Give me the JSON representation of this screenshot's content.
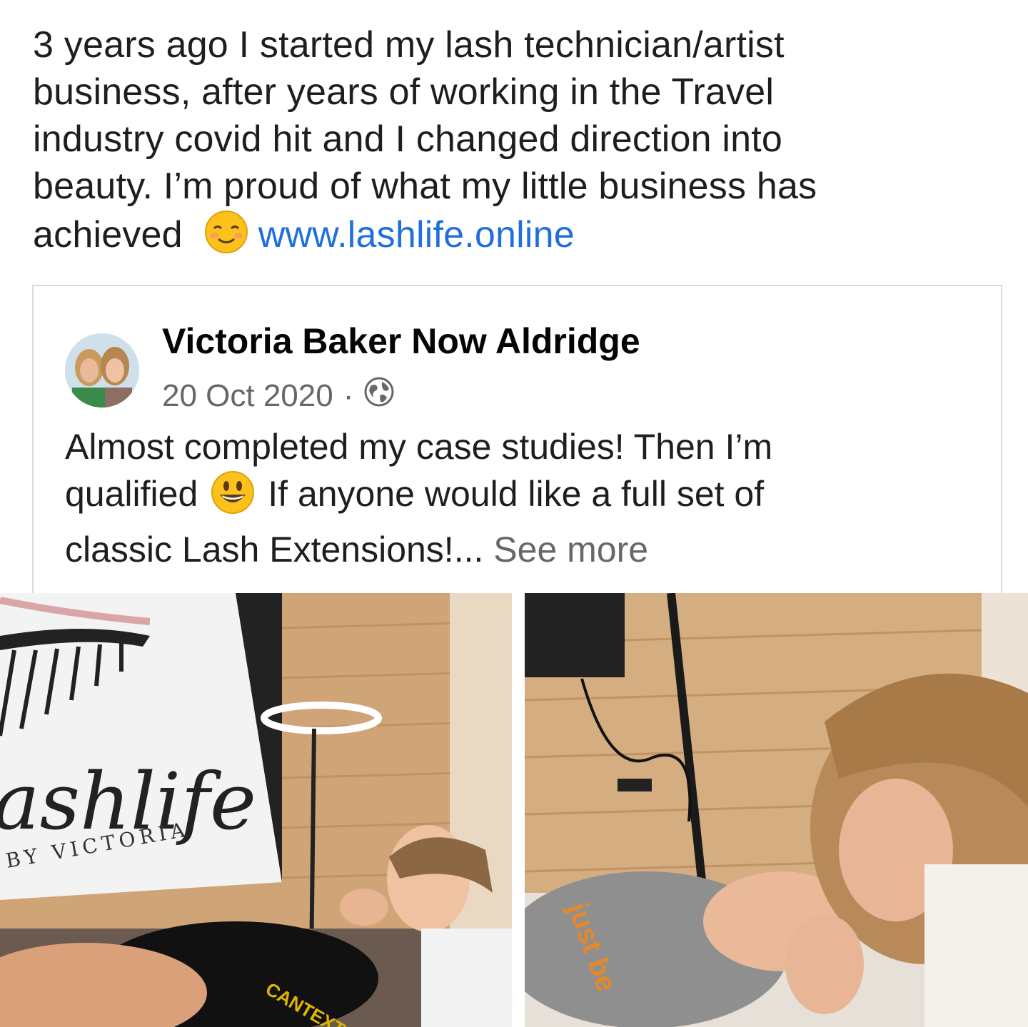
{
  "post": {
    "text_line1": "3 years ago I started my lash technician/artist",
    "text_line2": "business,  after years of working in the Travel",
    "text_line3": "industry covid hit and I changed direction into",
    "text_line4": "beauty. I’m proud of what my little business has",
    "text_line5_start": "achieved",
    "emoji": "smiling-blush-emoji",
    "link_text": "www.lashlife.online"
  },
  "shared_post": {
    "author": "Victoria Baker Now Aldridge",
    "date": "20 Oct 2020",
    "separator": "·",
    "privacy_icon": "globe-icon",
    "line1": "Almost completed my case studies! Then I’m",
    "line2_start": "qualified",
    "emoji": "grinning-emoji",
    "line2_end": "If anyone would like a full set of",
    "line3": "classic Lash Extensions!...",
    "see_more": "See more"
  },
  "photos": {
    "left_sign_main": "ashlife",
    "left_sign_sub": "BY VICTORIA",
    "left_shirt_text": "CANTEXTOUR",
    "right_shirt_text": "just be"
  },
  "colors": {
    "link": "#216fdb",
    "meta_gray": "#65676b",
    "card_border": "#d9dbdf"
  }
}
